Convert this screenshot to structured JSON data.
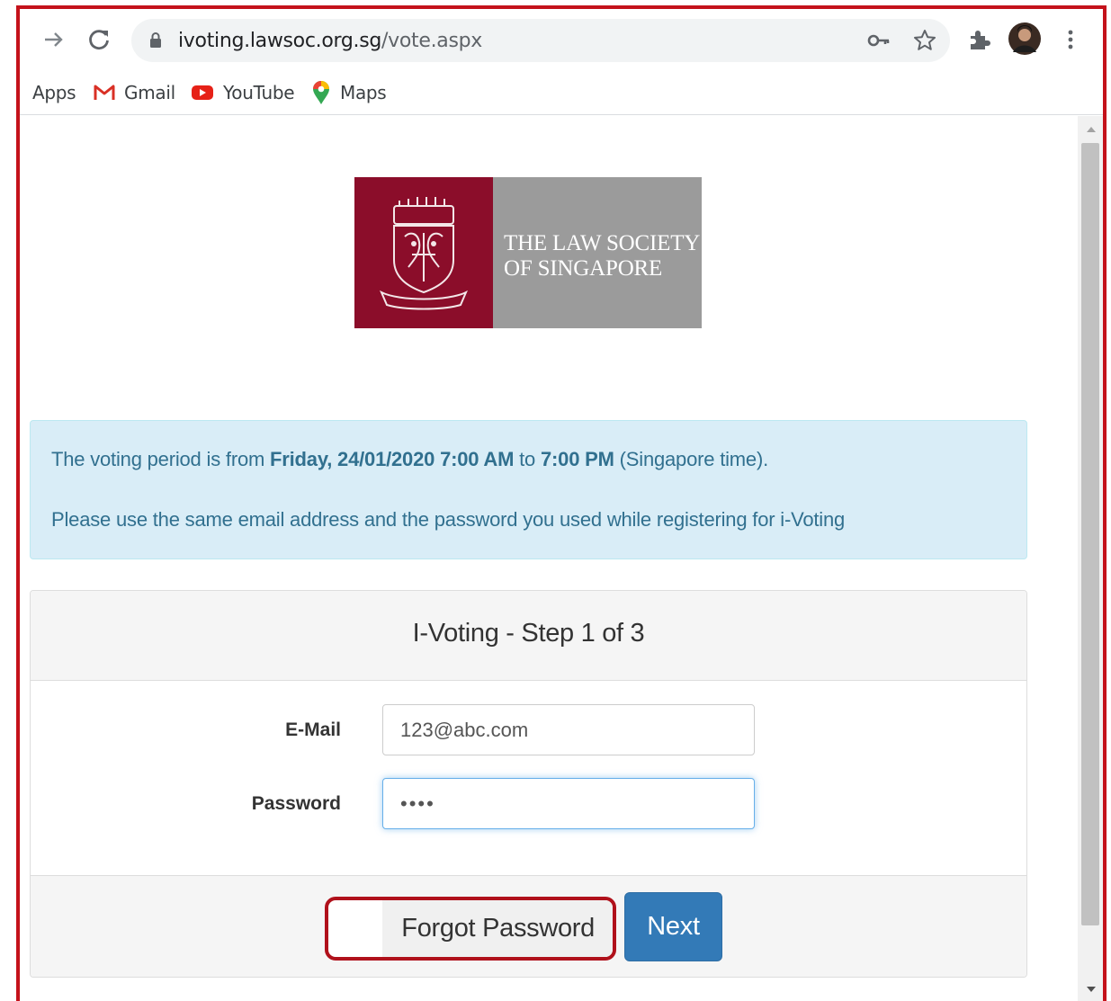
{
  "browser": {
    "url_host": "ivoting.lawsoc.org.sg",
    "url_path": "/vote.aspx",
    "bookmarks": [
      {
        "label": "Apps",
        "icon": "apps-icon"
      },
      {
        "label": "Gmail",
        "icon": "gmail-icon"
      },
      {
        "label": "YouTube",
        "icon": "youtube-icon"
      },
      {
        "label": "Maps",
        "icon": "maps-icon"
      }
    ]
  },
  "logo": {
    "line1": "THE LAW SOCIETY",
    "line2": "OF SINGAPORE",
    "crest_color": "#8b0d2a",
    "panel_color": "#9b9b9b"
  },
  "alert": {
    "pre1": "The voting period is from ",
    "start": "Friday, 24/01/2020 7:00 AM",
    "mid": " to ",
    "end": "7:00 PM",
    "post1": " (Singapore time).",
    "line2": "Please use the same email address and the password you used while registering for i-Voting"
  },
  "form": {
    "title": "I-Voting - Step 1 of 3",
    "email_label": "E-Mail",
    "email_value": "123@abc.com",
    "password_label": "Password",
    "password_value": "••••",
    "forgot_label": "Forgot Password",
    "next_label": "Next"
  },
  "colors": {
    "annotation_red": "#c4121b",
    "alert_bg": "#d9edf7",
    "primary_button": "#337ab7"
  }
}
